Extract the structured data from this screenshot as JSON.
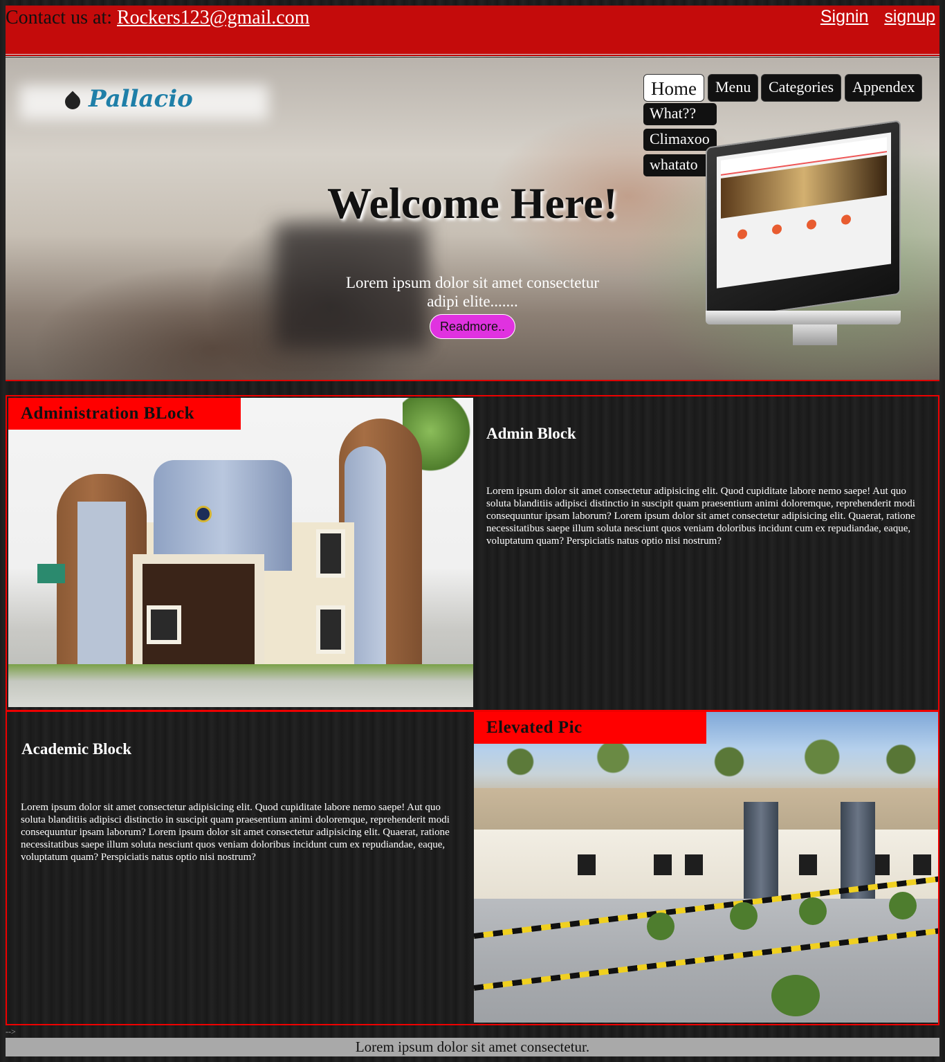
{
  "header": {
    "contact_prefix": "Contact us at: ",
    "contact_email": "Rockers123@gmail.com",
    "signin": "Signin",
    "signup": "signup"
  },
  "hero": {
    "logo_text": "Pallacio",
    "nav": [
      "Home",
      "Menu",
      "Categories",
      "Appendex"
    ],
    "dropdown": [
      "What??",
      "Climaxoo",
      "whatato"
    ],
    "title": "Welcome Here!",
    "tagline": "Lorem ipsum dolor sit amet consectetur adipi elite.......",
    "button": "Readmore.."
  },
  "blocks": {
    "admin": {
      "label": "Administration BLock",
      "title": "Admin Block",
      "text": "Lorem ipsum dolor sit amet consectetur adipisicing elit. Quod cupiditate labore nemo saepe! Aut quo soluta blanditiis adipisci distinctio in suscipit quam praesentium animi doloremque, reprehenderit modi consequuntur ipsam laborum? Lorem ipsum dolor sit amet consectetur adipisicing elit. Quaerat, ratione necessitatibus saepe illum soluta nesciunt quos veniam doloribus incidunt cum ex repudiandae, eaque, voluptatum quam? Perspiciatis natus optio nisi nostrum?"
    },
    "academic": {
      "label": "Elevated Pic",
      "title": "Academic Block",
      "text": "Lorem ipsum dolor sit amet consectetur adipisicing elit. Quod cupiditate labore nemo saepe! Aut quo soluta blanditiis adipisci distinctio in suscipit quam praesentium animi doloremque, reprehenderit modi consequuntur ipsam laborum? Lorem ipsum dolor sit amet consectetur adipisicing elit. Quaerat, ratione necessitatibus saepe illum soluta nesciunt quos veniam doloribus incidunt cum ex repudiandae, eaque, voluptatum quam? Perspiciatis natus optio nisi nostrum?"
    }
  },
  "stray_text": "-->",
  "footer": "Lorem ipsum dolor sit amet consectetur.",
  "colors": {
    "header_red": "#c40b0b",
    "label_red": "#ff0000",
    "button_pink": "#e032e0"
  }
}
